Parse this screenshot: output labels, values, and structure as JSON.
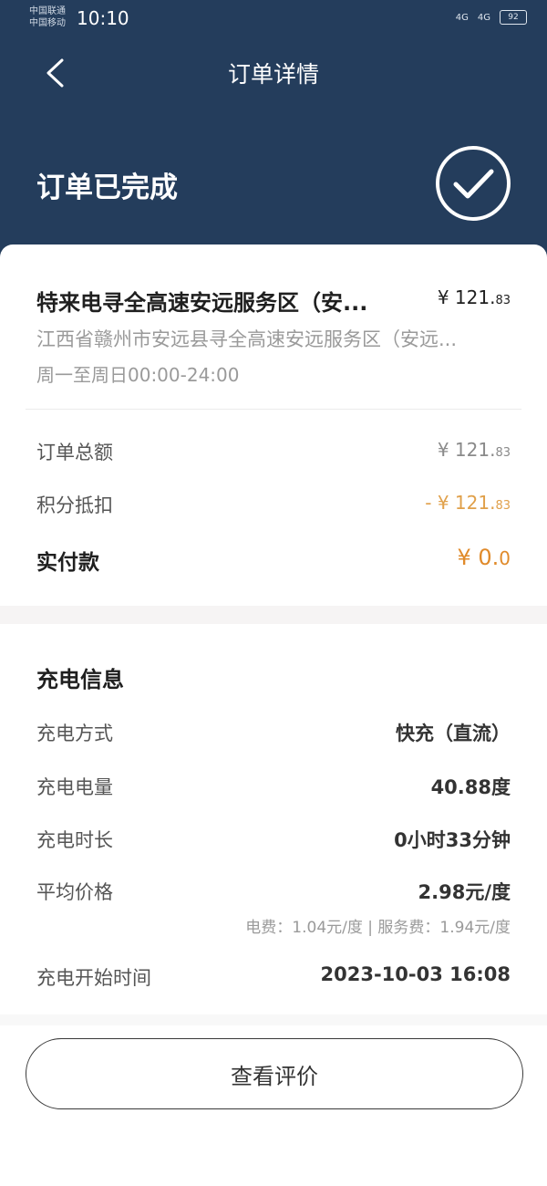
{
  "status_bar": {
    "carrier_1": "中国联通",
    "carrier_2": "中国移动",
    "time": "10:10",
    "signal_1": "4G",
    "signal_2": "4G",
    "battery": "92"
  },
  "nav": {
    "title": "订单详情"
  },
  "order_status": {
    "title": "订单已完成"
  },
  "station": {
    "name": "特来电寻全高速安远服务区（安...",
    "price": "¥ 121.",
    "price_cents": "83",
    "address": "江西省赣州市安远县寻全高速安远服务区（安远...",
    "hours": "周一至周日00:00-24:00"
  },
  "summary": {
    "total_label": "订单总额",
    "total_value": "¥ 121.",
    "total_cents": "83",
    "points_label": "积分抵扣",
    "points_value": "- ¥ 121.",
    "points_cents": "83",
    "paid_label": "实付款",
    "paid_value": "¥ 0.",
    "paid_cents": "0"
  },
  "charging": {
    "section_title": "充电信息",
    "mode_label": "充电方式",
    "mode_value": "快充（直流）",
    "energy_label": "充电电量",
    "energy_value": "40.88度",
    "duration_label": "充电时长",
    "duration_value": "0小时33分钟",
    "avg_price_label": "平均价格",
    "avg_price_value": "2.98元/度",
    "fee_detail": "电费：1.04元/度 | 服务费：1.94元/度",
    "start_label": "充电开始时间",
    "start_value": "2023-10-03 16:08"
  },
  "actions": {
    "review_label": "查看评价"
  },
  "colors": {
    "header_bg": "#243d5c",
    "accent_orange": "#e08a2a",
    "discount": "#e0a04a"
  }
}
